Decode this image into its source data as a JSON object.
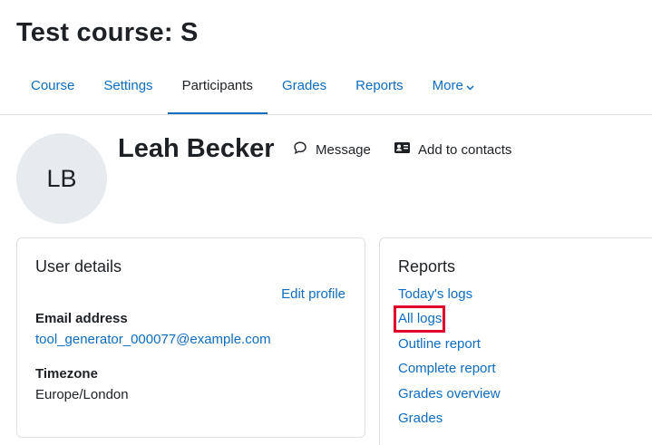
{
  "course": {
    "title": "Test course: S"
  },
  "nav": {
    "tabs": [
      {
        "label": "Course"
      },
      {
        "label": "Settings"
      },
      {
        "label": "Participants",
        "active": true
      },
      {
        "label": "Grades"
      },
      {
        "label": "Reports"
      },
      {
        "label": "More"
      }
    ]
  },
  "user": {
    "initials": "LB",
    "name": "Leah Becker",
    "message_label": "Message",
    "add_contacts_label": "Add to contacts"
  },
  "user_details": {
    "title": "User details",
    "edit_profile_label": "Edit profile",
    "email_label": "Email address",
    "email_value": "tool_generator_000077@example.com",
    "timezone_label": "Timezone",
    "timezone_value": "Europe/London"
  },
  "reports": {
    "title": "Reports",
    "links": [
      {
        "label": "Today's logs"
      },
      {
        "label": "All logs",
        "highlighted": true
      },
      {
        "label": "Outline report"
      },
      {
        "label": "Complete report"
      },
      {
        "label": "Grades overview"
      },
      {
        "label": "Grades"
      }
    ]
  },
  "colors": {
    "link": "#0f6cbf",
    "text": "#1d2125",
    "highlight": "#e0002a",
    "avatar_bg": "#e8ebee",
    "border": "#dee2e6"
  }
}
